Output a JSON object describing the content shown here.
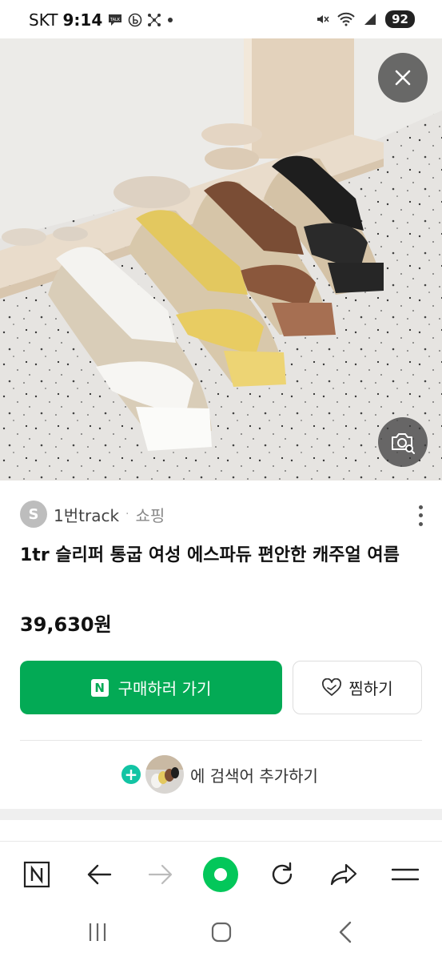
{
  "status_bar": {
    "carrier": "SKT",
    "time": "9:14",
    "battery": "92",
    "icons": [
      "talk-icon",
      "b-app-icon",
      "network-icon",
      "dot-icon",
      "mute-icon",
      "wifi-icon",
      "signal-icon"
    ]
  },
  "hero": {
    "image": "product-photo-sandals",
    "close_icon": "close-icon",
    "lens_icon": "image-search-icon"
  },
  "seller": {
    "avatar_letter": "S",
    "name": "1번track",
    "separator": "·",
    "category": "쇼핑"
  },
  "product": {
    "title": "1tr 슬리퍼 통굽 여성 에스파듀 편안한 캐주얼 여름",
    "price": "39,630원"
  },
  "actions": {
    "buy_badge": "N",
    "buy_label": "구매하러 가기",
    "wish_label": "찜하기"
  },
  "add_search": {
    "label": "에 검색어 추가하기",
    "plus": "+"
  },
  "toolbar": {
    "items": [
      "naver-home-icon",
      "back-icon",
      "forward-icon",
      "green-dot-icon",
      "refresh-icon",
      "share-icon",
      "menu-icon"
    ]
  },
  "navbar": {
    "items": [
      "recent-apps-icon",
      "home-icon",
      "back-nav-icon"
    ]
  },
  "colors": {
    "brand_green": "#03aa55",
    "plus_teal": "#12c4a4"
  }
}
